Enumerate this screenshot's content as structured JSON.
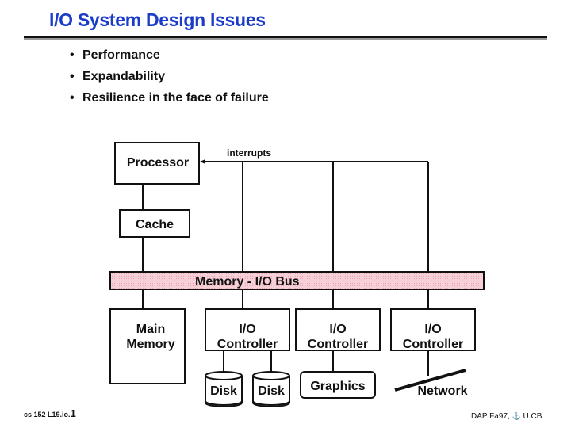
{
  "slide": {
    "title": "I/O System Design Issues",
    "title_color": "#1a3cc8",
    "bullets": [
      "Performance",
      "Expandability",
      "Resilience in the face of failure"
    ]
  },
  "diagram": {
    "processor": "Processor",
    "cache": "Cache",
    "interrupts_label": "interrupts",
    "bus_label": "Memory - I/O Bus",
    "bus_fill_color": "#f5c2cc",
    "main_memory": [
      "Main",
      "Memory"
    ],
    "io_controllers": [
      [
        "I/O",
        "Controller"
      ],
      [
        "I/O",
        "Controller"
      ],
      [
        "I/O",
        "Controller"
      ]
    ],
    "devices": {
      "disk1": "Disk",
      "disk2": "Disk",
      "graphics": "Graphics",
      "network": "Network"
    }
  },
  "footer": {
    "course": "cs 152  L19.io.",
    "page": "1",
    "credit": "DAP Fa97,",
    "credit_icon": "bear-icon",
    "credit_suffix": "U.CB"
  }
}
